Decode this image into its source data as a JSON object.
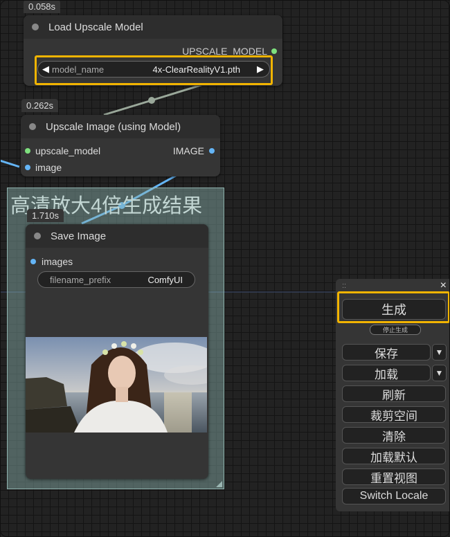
{
  "nodes": {
    "load_upscale": {
      "timing": "0.058s",
      "title": "Load Upscale Model",
      "output_label": "UPSCALE_MODEL",
      "widget": {
        "label": "model_name",
        "value": "4x-ClearRealityV1.pth"
      }
    },
    "upscale_image": {
      "timing": "0.262s",
      "title": "Upscale Image (using Model)",
      "inputs": [
        "upscale_model",
        "image"
      ],
      "output_label": "IMAGE"
    },
    "save_image": {
      "timing": "1.710s",
      "title": "Save Image",
      "input_label": "images",
      "widget": {
        "label": "filename_prefix",
        "value": "ComfyUI"
      }
    }
  },
  "group": {
    "title": "高清放大4倍生成结果"
  },
  "menu": {
    "handle": "::",
    "close": "×",
    "queue_button": "生成",
    "interrupt_button": "停止生成",
    "buttons": [
      "保存",
      "加载",
      "刷新",
      "裁剪空间",
      "清除",
      "加载默认",
      "重置视图",
      "Switch Locale"
    ],
    "dropdown_glyph": "▼"
  },
  "colors": {
    "highlight": "#f2b400",
    "upscale_model_slot": "#7ee07e",
    "image_slot": "#64b5f6",
    "link_model": "#9aa89a",
    "link_image": "#64b5f6"
  }
}
